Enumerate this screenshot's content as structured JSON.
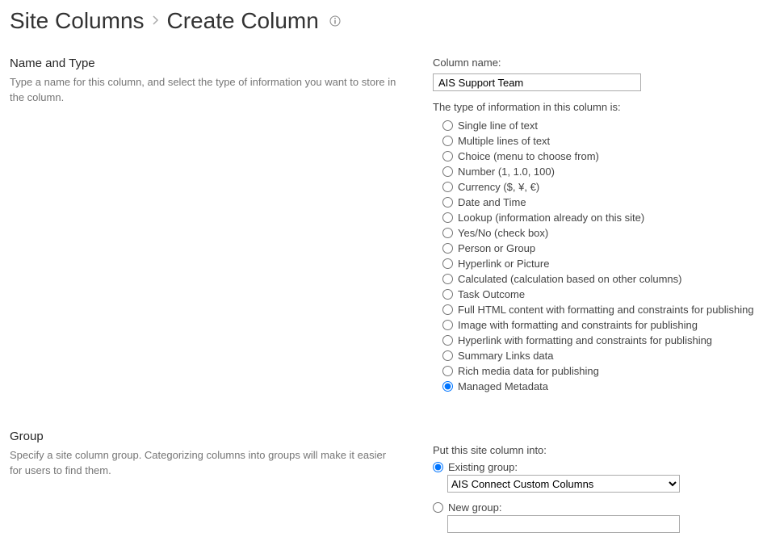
{
  "breadcrumb": {
    "parent": "Site Columns",
    "current": "Create Column"
  },
  "section_name_type": {
    "heading": "Name and Type",
    "desc": "Type a name for this column, and select the type of information you want to store in the column."
  },
  "column_name": {
    "label": "Column name:",
    "value": "AIS Support Team"
  },
  "type_label": "The type of information in this column is:",
  "types": [
    "Single line of text",
    "Multiple lines of text",
    "Choice (menu to choose from)",
    "Number (1, 1.0, 100)",
    "Currency ($, ¥, €)",
    "Date and Time",
    "Lookup (information already on this site)",
    "Yes/No (check box)",
    "Person or Group",
    "Hyperlink or Picture",
    "Calculated (calculation based on other columns)",
    "Task Outcome",
    "Full HTML content with formatting and constraints for publishing",
    "Image with formatting and constraints for publishing",
    "Hyperlink with formatting and constraints for publishing",
    "Summary Links data",
    "Rich media data for publishing",
    "Managed Metadata"
  ],
  "types_selected_index": 17,
  "section_group": {
    "heading": "Group",
    "desc": "Specify a site column group. Categorizing columns into groups will make it easier for users to find them."
  },
  "group_put_label": "Put this site column into:",
  "group_existing_label": "Existing group:",
  "group_existing_value": "AIS Connect Custom Columns",
  "group_new_label": "New group:",
  "group_new_value": "",
  "group_selected": "existing"
}
